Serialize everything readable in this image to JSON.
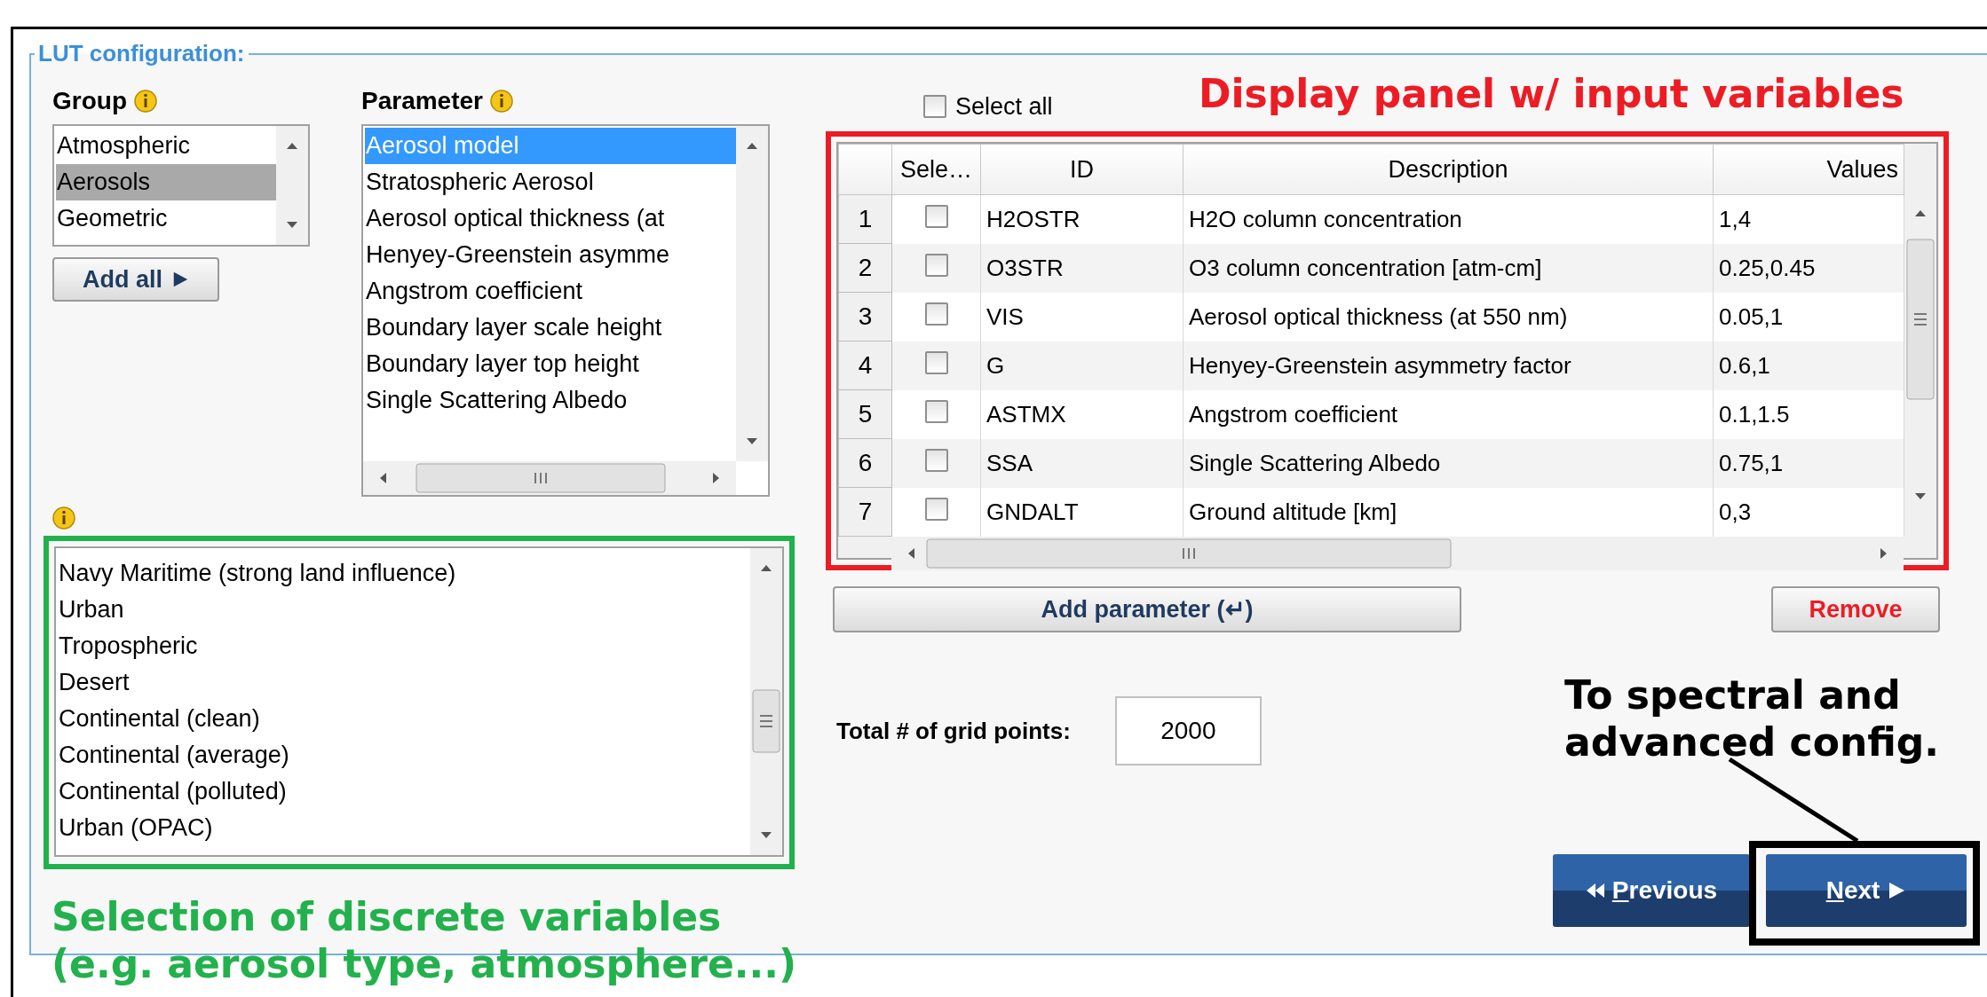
{
  "legend": "LUT configuration:",
  "group": {
    "label": "Group",
    "focused": false,
    "items": [
      {
        "label": "Atmospheric",
        "selected": false
      },
      {
        "label": "Aerosols",
        "selected": true
      },
      {
        "label": "Geometric",
        "selected": false
      }
    ],
    "add_all": "Add all"
  },
  "parameter": {
    "label": "Parameter",
    "focused": true,
    "items": [
      {
        "label": "Aerosol model",
        "selected": true
      },
      {
        "label": "Stratospheric Aerosol",
        "selected": false
      },
      {
        "label": "Aerosol optical thickness (at",
        "selected": false
      },
      {
        "label": "Henyey-Greenstein asymme",
        "selected": false
      },
      {
        "label": "Angstrom coefficient",
        "selected": false
      },
      {
        "label": "Boundary layer scale height",
        "selected": false
      },
      {
        "label": "Boundary layer top height",
        "selected": false
      },
      {
        "label": "Single Scattering Albedo",
        "selected": false
      }
    ]
  },
  "discrete": {
    "items": [
      "Navy Maritime (strong land influence)",
      "Urban",
      "Tropospheric",
      "Desert",
      "Continental (clean)",
      "Continental (average)",
      "Continental (polluted)",
      "Urban (OPAC)"
    ]
  },
  "select_all": {
    "label": "Select all",
    "checked": false
  },
  "table": {
    "columns": [
      "Sele…",
      "ID",
      "Description",
      "Values"
    ],
    "rows": [
      {
        "number": "1",
        "checked": false,
        "id": "H2OSTR",
        "description": "H2O column concentration",
        "values": "1,4"
      },
      {
        "number": "2",
        "checked": false,
        "id": "O3STR",
        "description": "O3 column concentration [atm-cm]",
        "values": "0.25,0.45"
      },
      {
        "number": "3",
        "checked": false,
        "id": "VIS",
        "description": "Aerosol optical thickness (at 550 nm)",
        "values": "0.05,1"
      },
      {
        "number": "4",
        "checked": false,
        "id": "G",
        "description": "Henyey-Greenstein asymmetry factor",
        "values": "0.6,1"
      },
      {
        "number": "5",
        "checked": false,
        "id": "ASTMX",
        "description": "Angstrom coefficient",
        "values": "0.1,1.5"
      },
      {
        "number": "6",
        "checked": false,
        "id": "SSA",
        "description": "Single Scattering Albedo",
        "values": "0.75,1"
      },
      {
        "number": "7",
        "checked": false,
        "id": "GNDALT",
        "description": "Ground altitude [km]",
        "values": "0,3"
      }
    ]
  },
  "add_parameter": "Add parameter (↵)",
  "remove": "Remove",
  "grid_points": {
    "label": "Total # of grid points:",
    "value": "2000"
  },
  "nav": {
    "previous": "Previous",
    "next": "Next"
  },
  "annotations": [
    {
      "kind": "panel",
      "lines": [
        "Display panel w/ input variables"
      ],
      "color": "#ed1c24"
    },
    {
      "kind": "selection",
      "lines": [
        "Selection of discrete variables",
        "(e.g. aerosol type, atmosphere...)"
      ],
      "color": "#22b14c"
    },
    {
      "kind": "navigation",
      "lines": [
        "To spectral and",
        "advanced config."
      ],
      "color": "#000000"
    }
  ]
}
